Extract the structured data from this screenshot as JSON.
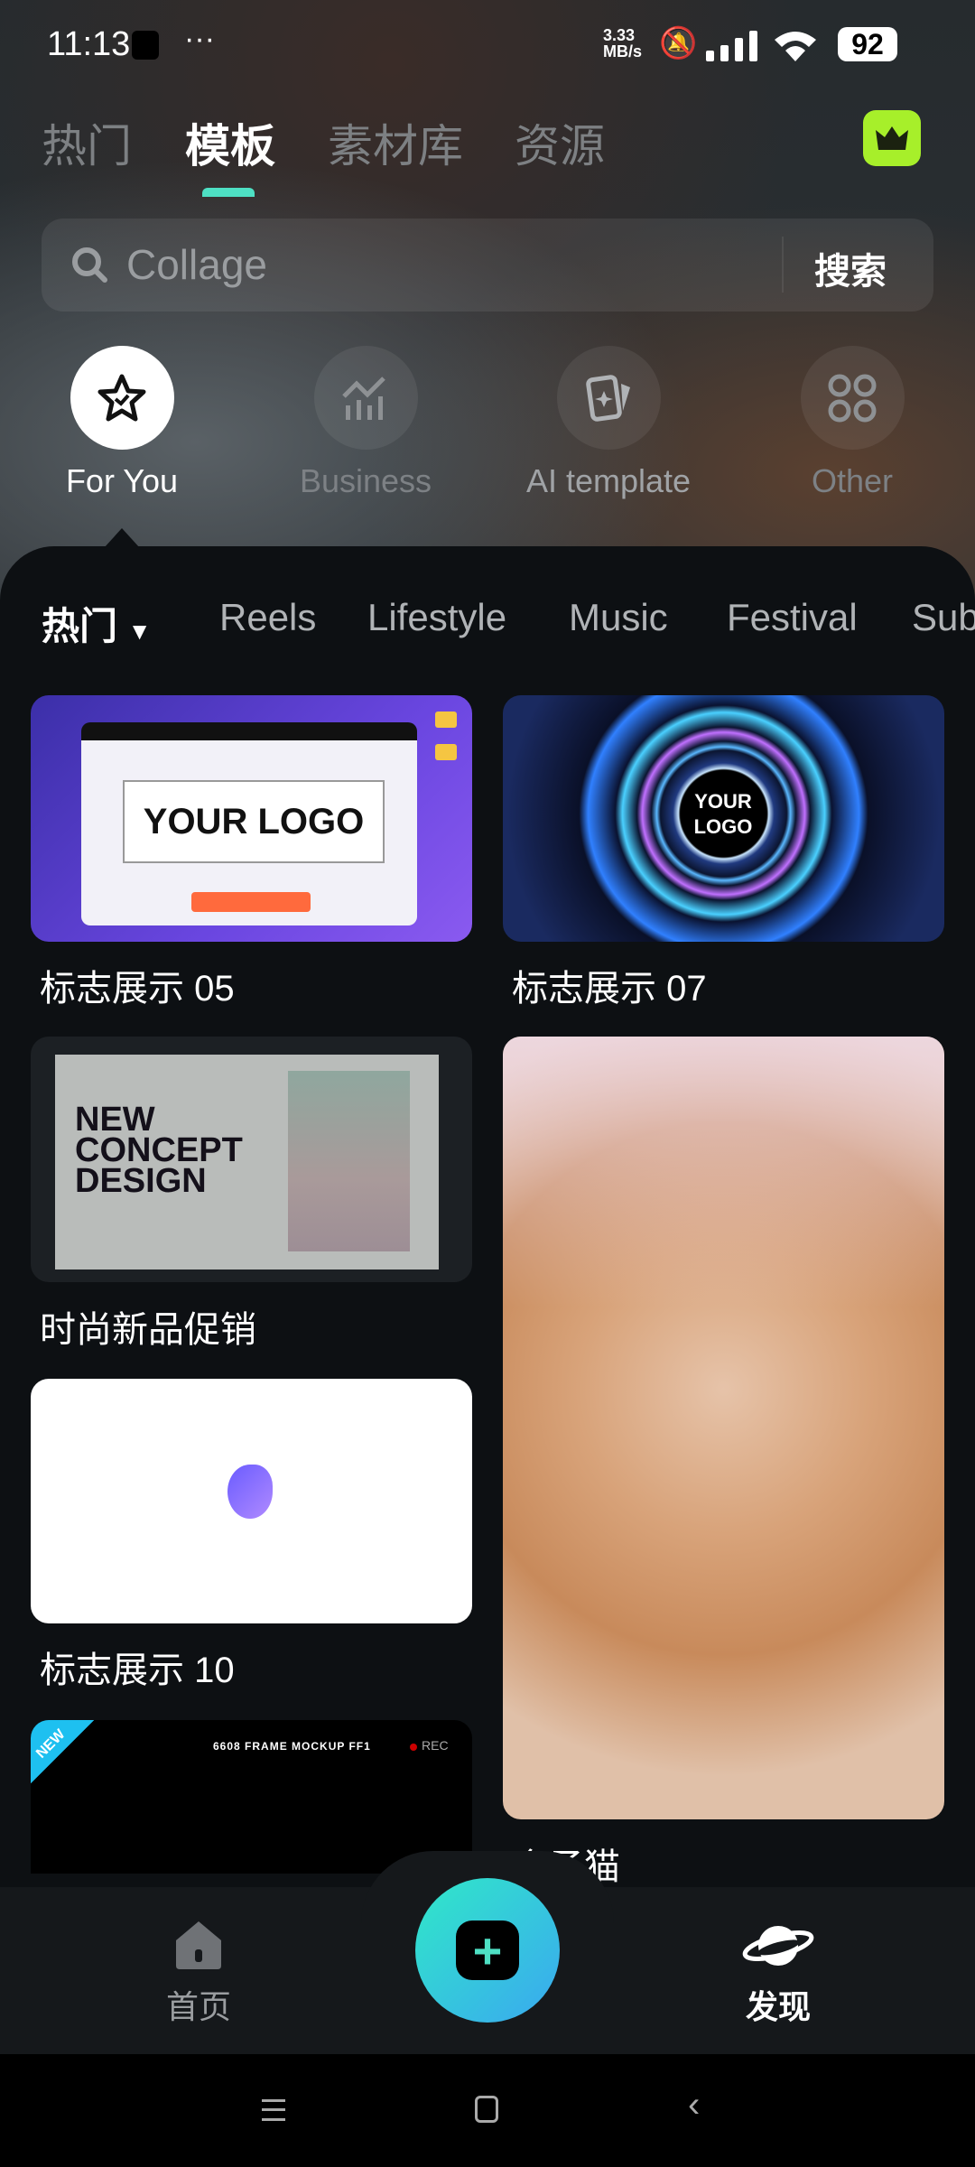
{
  "status": {
    "time": "11:13",
    "speed": "3.33",
    "speed_unit": "MB/s",
    "battery": "92"
  },
  "top_tabs": [
    {
      "label": "热门"
    },
    {
      "label": "模板",
      "active": true
    },
    {
      "label": "素材库"
    },
    {
      "label": "资源"
    }
  ],
  "search": {
    "placeholder": "Collage",
    "button": "搜索"
  },
  "categories": [
    {
      "label": "For You",
      "icon": "star-check-icon",
      "active": true
    },
    {
      "label": "Business",
      "icon": "chart-icon"
    },
    {
      "label": "AI template",
      "icon": "ai-card-icon"
    },
    {
      "label": "Other",
      "icon": "grid-icon"
    }
  ],
  "filters": [
    {
      "label": "热门"
    },
    {
      "label": "Reels"
    },
    {
      "label": "Lifestyle"
    },
    {
      "label": "Music"
    },
    {
      "label": "Festival"
    },
    {
      "label": "Sub"
    }
  ],
  "cards": [
    {
      "title": "标志展示 05",
      "thumb_text": "YOUR LOGO"
    },
    {
      "title": "标志展示 07",
      "thumb_text": "YOUR LOGO"
    },
    {
      "title": "时尚新品促销",
      "thumb_text": "NEW CONCEPT DESIGN"
    },
    {
      "title": "标志展示 10"
    },
    {
      "title": "含子猫"
    },
    {
      "badge": "NEW",
      "thumb_text": "6608 FRAME MOCKUP FF1",
      "rec": "REC"
    }
  ],
  "bottom_nav": [
    {
      "label": "首页",
      "icon": "home-icon"
    },
    {
      "label": "发现",
      "icon": "planet-icon",
      "active": true
    }
  ],
  "colors": {
    "accent": "#4ee0c4",
    "vip": "#a7ef2a"
  }
}
